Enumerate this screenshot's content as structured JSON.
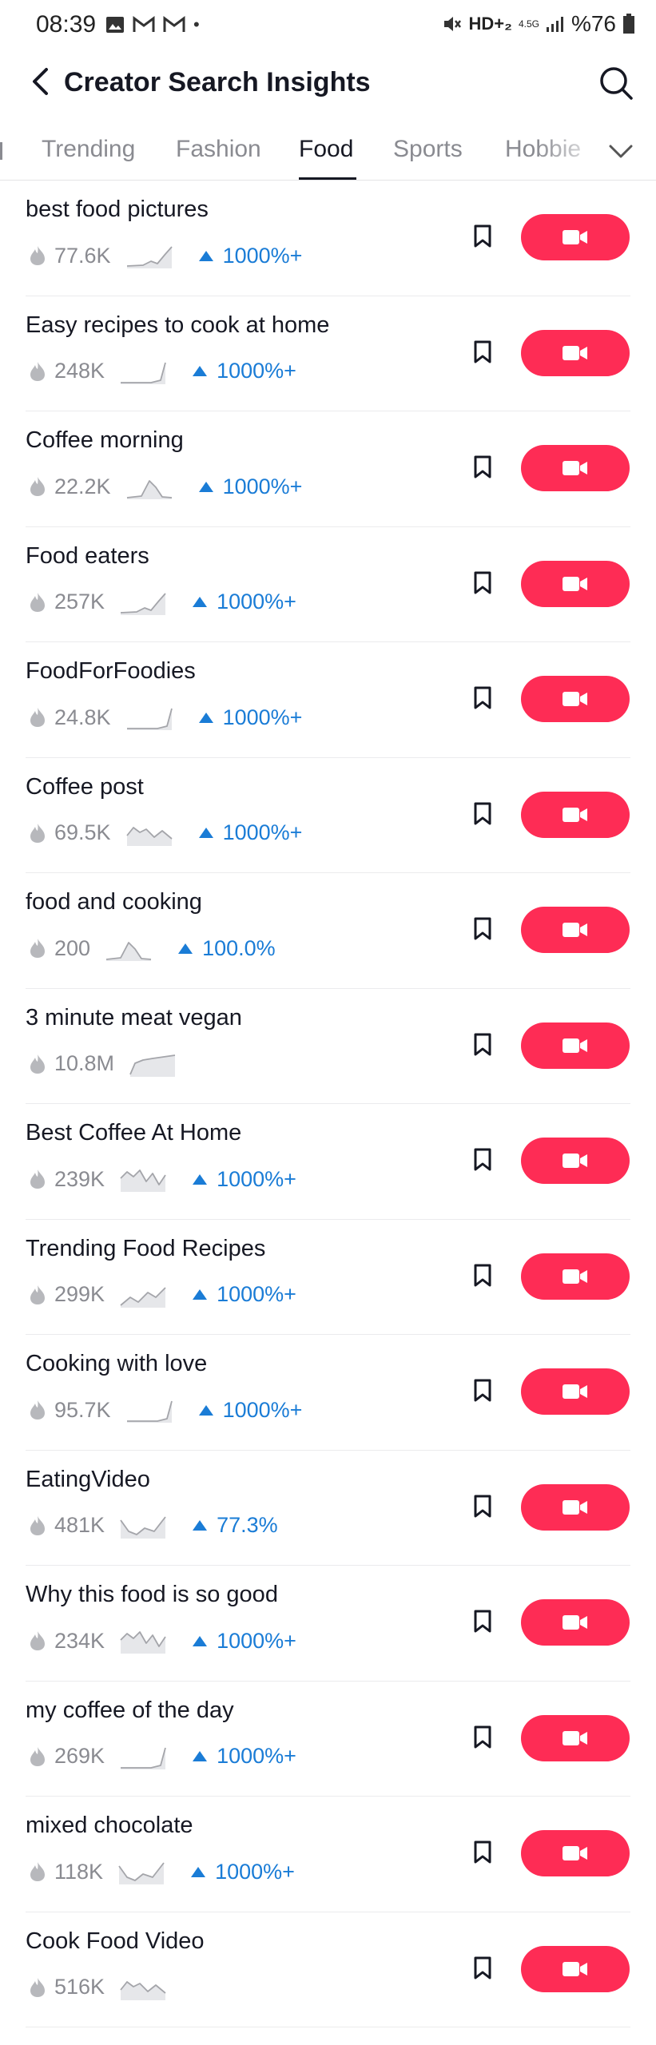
{
  "status_bar": {
    "time": "08:39",
    "dot": "•",
    "network": "HD+₂",
    "network_small": "4.5G",
    "battery": "%76",
    "icons": [
      "image-icon",
      "gmail-icon",
      "gmail-icon",
      "mute-icon",
      "signal-icon",
      "battery-icon"
    ]
  },
  "header": {
    "title": "Creator Search Insights",
    "back_icon": "chevron-left-icon",
    "search_icon": "search-icon"
  },
  "tabs": [
    {
      "label": "Trending"
    },
    {
      "label": "Fashion"
    },
    {
      "label": "Food"
    },
    {
      "label": "Sports"
    },
    {
      "label": "Hobbie"
    }
  ],
  "active_tab": "Food",
  "colors": {
    "accent": "#fe2c55",
    "trend_blue": "#1a7cd6",
    "muted": "#8a8b91",
    "text": "#161823"
  },
  "items": [
    {
      "title": "best food pictures",
      "views": "77.6K",
      "trend": "1000%+",
      "spark": "upslope"
    },
    {
      "title": "Easy recipes to cook at home",
      "views": "248K",
      "trend": "1000%+",
      "spark": "flat-rise"
    },
    {
      "title": "Coffee morning",
      "views": "22.2K",
      "trend": "1000%+",
      "spark": "peak"
    },
    {
      "title": "Food eaters",
      "views": "257K",
      "trend": "1000%+",
      "spark": "upslope"
    },
    {
      "title": "FoodForFoodies",
      "views": "24.8K",
      "trend": "1000%+",
      "spark": "flat-rise"
    },
    {
      "title": "Coffee post",
      "views": "69.5K",
      "trend": "1000%+",
      "spark": "waves"
    },
    {
      "title": "food and cooking",
      "views": "200",
      "trend": "100.0%",
      "spark": "peak"
    },
    {
      "title": "3 minute meat vegan",
      "views": "10.8M",
      "trend": "",
      "spark": "plateau"
    },
    {
      "title": "Best Coffee At Home",
      "views": "239K",
      "trend": "1000%+",
      "spark": "zigzag"
    },
    {
      "title": "Trending Food Recipes",
      "views": "299K",
      "trend": "1000%+",
      "spark": "rise-wave"
    },
    {
      "title": "Cooking with love",
      "views": "95.7K",
      "trend": "1000%+",
      "spark": "flat-rise"
    },
    {
      "title": "EatingVideo",
      "views": "481K",
      "trend": "77.3%",
      "spark": "valley"
    },
    {
      "title": "Why this food is so good",
      "views": "234K",
      "trend": "1000%+",
      "spark": "zigzag"
    },
    {
      "title": "my coffee of the day",
      "views": "269K",
      "trend": "1000%+",
      "spark": "flat-rise"
    },
    {
      "title": "mixed chocolate",
      "views": "118K",
      "trend": "1000%+",
      "spark": "valley"
    },
    {
      "title": "Cook Food Video",
      "views": "516K",
      "trend": "",
      "spark": "waves"
    }
  ]
}
